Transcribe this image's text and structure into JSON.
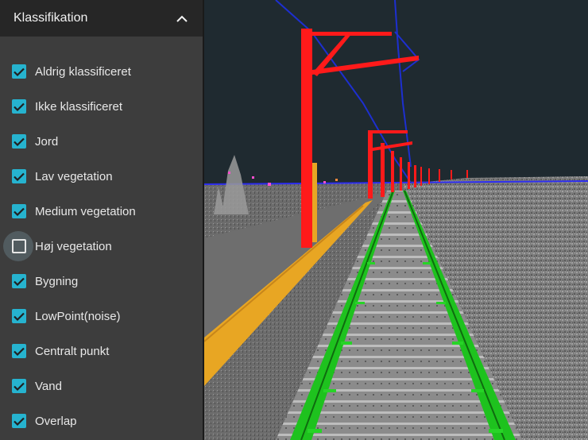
{
  "panel": {
    "title": "Klassifikation",
    "collapse_icon": "chevron-up-icon",
    "items": [
      {
        "label": "Aldrig klassificeret",
        "checked": true
      },
      {
        "label": "Ikke klassificeret",
        "checked": true
      },
      {
        "label": "Jord",
        "checked": true
      },
      {
        "label": "Lav vegetation",
        "checked": true
      },
      {
        "label": "Medium vegetation",
        "checked": true
      },
      {
        "label": "Høj vegetation",
        "checked": false,
        "focused": true
      },
      {
        "label": "Bygning",
        "checked": true
      },
      {
        "label": "LowPoint(noise)",
        "checked": true
      },
      {
        "label": "Centralt punkt",
        "checked": true
      },
      {
        "label": "Vand",
        "checked": true
      },
      {
        "label": "Overlap",
        "checked": true
      }
    ]
  },
  "colors": {
    "accent": "#26b3cf",
    "panel_bg": "#3d3d3d",
    "header_bg": "#262626",
    "sky": "#1f2a30",
    "mast": "#ff1a1a",
    "wire": "#1d2fd0",
    "rail": "#1ec21e",
    "platform_edge": "#e8a623",
    "ground": "#8a8a8a"
  }
}
